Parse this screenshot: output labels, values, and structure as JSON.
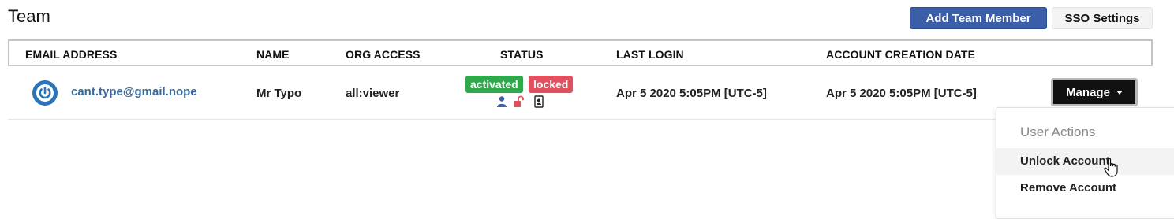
{
  "page": {
    "title": "Team"
  },
  "header_buttons": {
    "add_member": "Add Team Member",
    "sso_settings": "SSO Settings"
  },
  "table": {
    "columns": [
      "EMAIL ADDRESS",
      "NAME",
      "ORG ACCESS",
      "STATUS",
      "LAST LOGIN",
      "ACCOUNT CREATION DATE"
    ],
    "rows": [
      {
        "email": "cant.type@gmail.nope",
        "name": "Mr Typo",
        "org_access": "all:viewer",
        "status_badges": [
          "activated",
          "locked"
        ],
        "status_icons": [
          "user-icon",
          "unlocked-padlock-icon",
          "id-badge-icon"
        ],
        "last_login": "Apr 5 2020 5:05PM [UTC-5]",
        "created": "Apr 5 2020 5:05PM [UTC-5]",
        "manage_label": "Manage"
      }
    ]
  },
  "dropdown": {
    "header": "User Actions",
    "items": [
      "Unlock Account",
      "Remove Account"
    ]
  },
  "colors": {
    "primary_button": "#3b5ea8",
    "badge_activated": "#2ea84a",
    "badge_locked": "#e0505f",
    "email_link": "#3a6a9a",
    "avatar": "#2a73b8"
  }
}
